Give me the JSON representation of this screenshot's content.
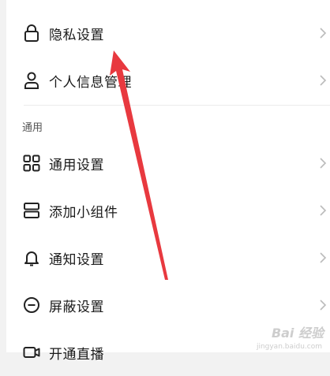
{
  "settings": {
    "items_top": [
      {
        "label": "隐私设置",
        "icon": "lock-icon"
      },
      {
        "label": "个人信息管理",
        "icon": "person-icon"
      }
    ],
    "section_general": "通用",
    "items_general": [
      {
        "label": "通用设置",
        "icon": "grid-icon"
      },
      {
        "label": "添加小组件",
        "icon": "widget-icon"
      },
      {
        "label": "通知设置",
        "icon": "bell-icon"
      },
      {
        "label": "屏蔽设置",
        "icon": "block-icon"
      },
      {
        "label": "开通直播",
        "icon": "video-icon"
      }
    ]
  },
  "annotation": {
    "arrow_color": "#e8393f"
  },
  "watermark": {
    "text": "Bai 经验",
    "sub": "jingyan.baidu.com"
  }
}
